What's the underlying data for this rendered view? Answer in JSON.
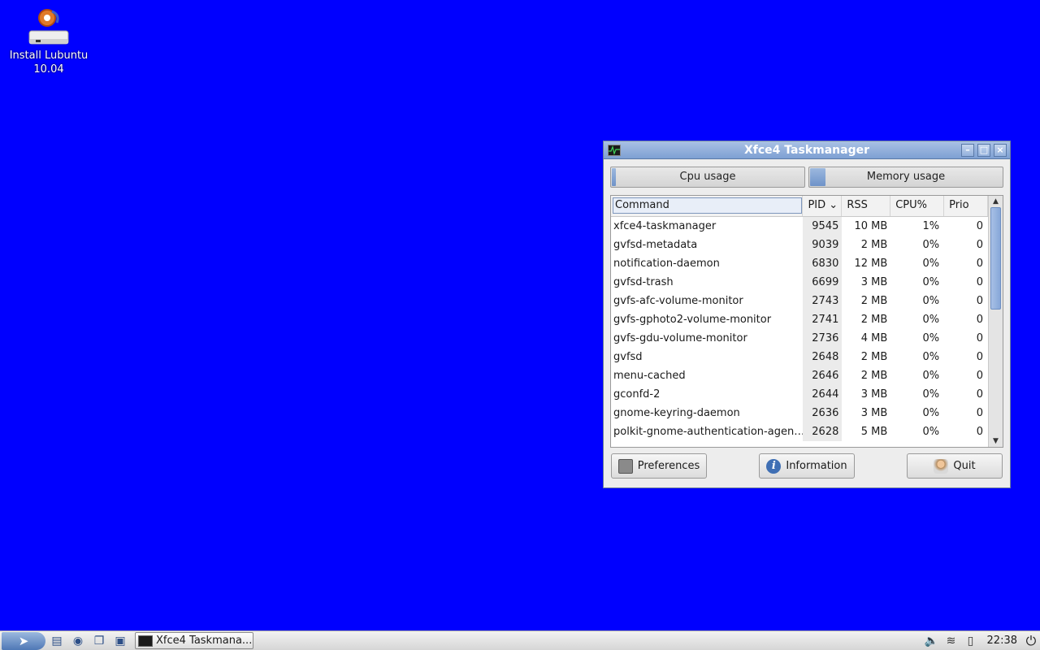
{
  "desktop": {
    "icon_label_line1": "Install Lubuntu",
    "icon_label_line2": "10.04"
  },
  "window": {
    "title": "Xfce4 Taskmanager",
    "meters": {
      "cpu_label": "Cpu usage",
      "cpu_fraction": 0.01,
      "mem_label": "Memory usage",
      "mem_fraction": 0.08
    },
    "columns": {
      "command": "Command",
      "pid": "PID",
      "rss": "RSS",
      "cpu": "CPU%",
      "prio": "Prio"
    },
    "processes": [
      {
        "command": "xfce4-taskmanager",
        "pid": "9545",
        "rss": "10 MB",
        "cpu": "1%",
        "prio": "0"
      },
      {
        "command": "gvfsd-metadata",
        "pid": "9039",
        "rss": "2 MB",
        "cpu": "0%",
        "prio": "0"
      },
      {
        "command": "notification-daemon",
        "pid": "6830",
        "rss": "12 MB",
        "cpu": "0%",
        "prio": "0"
      },
      {
        "command": "gvfsd-trash",
        "pid": "6699",
        "rss": "3 MB",
        "cpu": "0%",
        "prio": "0"
      },
      {
        "command": "gvfs-afc-volume-monitor",
        "pid": "2743",
        "rss": "2 MB",
        "cpu": "0%",
        "prio": "0"
      },
      {
        "command": "gvfs-gphoto2-volume-monitor",
        "pid": "2741",
        "rss": "2 MB",
        "cpu": "0%",
        "prio": "0"
      },
      {
        "command": "gvfs-gdu-volume-monitor",
        "pid": "2736",
        "rss": "4 MB",
        "cpu": "0%",
        "prio": "0"
      },
      {
        "command": "gvfsd",
        "pid": "2648",
        "rss": "2 MB",
        "cpu": "0%",
        "prio": "0"
      },
      {
        "command": "menu-cached",
        "pid": "2646",
        "rss": "2 MB",
        "cpu": "0%",
        "prio": "0"
      },
      {
        "command": "gconfd-2",
        "pid": "2644",
        "rss": "3 MB",
        "cpu": "0%",
        "prio": "0"
      },
      {
        "command": "gnome-keyring-daemon",
        "pid": "2636",
        "rss": "3 MB",
        "cpu": "0%",
        "prio": "0"
      },
      {
        "command": "polkit-gnome-authentication-agen…",
        "pid": "2628",
        "rss": "5 MB",
        "cpu": "0%",
        "prio": "0"
      }
    ],
    "buttons": {
      "preferences": "Preferences",
      "information": "Information",
      "quit": "Quit"
    }
  },
  "taskbar": {
    "task_label": "Xfce4 Taskmana...",
    "clock": "22:38"
  }
}
